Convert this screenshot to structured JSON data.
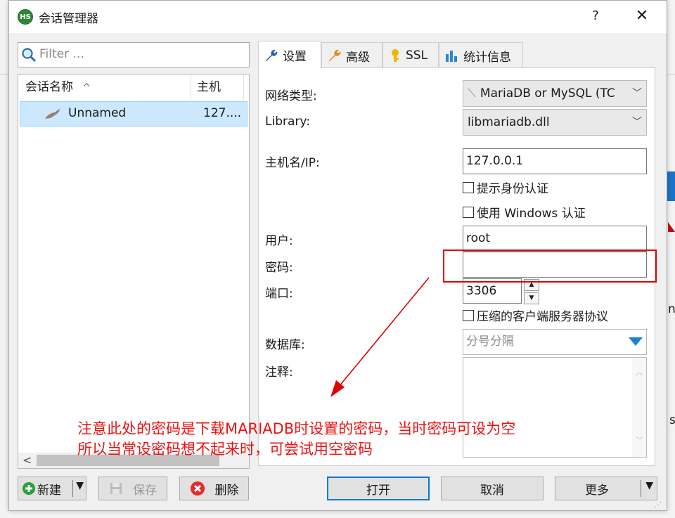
{
  "window": {
    "title": "会话管理器",
    "help_label": "?",
    "close_label": "✕",
    "app_icon_text": "HS"
  },
  "filter": {
    "placeholder": "Filter ..."
  },
  "session_list": {
    "columns": [
      {
        "label": "会话名称",
        "sort_indicator": "^"
      },
      {
        "label": "主机"
      }
    ],
    "rows": [
      {
        "name": "Unnamed",
        "host": "127...."
      }
    ],
    "scroll_left": "<"
  },
  "tabs": [
    {
      "label": "设置",
      "icon": "wrench-icon"
    },
    {
      "label": "高级",
      "icon": "wrench-icon"
    },
    {
      "label": "SSL",
      "icon": "key-icon"
    },
    {
      "label": "统计信息",
      "icon": "bar-chart-icon"
    }
  ],
  "settings": {
    "network_type_label": "网络类型:",
    "network_type_value": "MariaDB or MySQL (TC",
    "library_label": "Library:",
    "library_value": "libmariadb.dll",
    "host_label": "主机名/IP:",
    "host_value": "127.0.0.1",
    "prompt_auth_label": "提示身份认证",
    "windows_auth_label": "使用 Windows 认证",
    "user_label": "用户:",
    "user_value": "root",
    "password_label": "密码:",
    "password_value": "",
    "port_label": "端口:",
    "port_value": "3306",
    "compress_label": "压缩的客户端服务器协议",
    "database_label": "数据库:",
    "database_placeholder": "分号分隔",
    "comment_label": "注释:"
  },
  "buttons": {
    "new": "新建",
    "save": "保存",
    "delete": "删除",
    "open": "打开",
    "cancel": "取消",
    "more": "更多"
  },
  "annotation": {
    "line1": "注意此处的密码是下载MARIADB时设置的密码，当时密码可设为空",
    "line2": "所以当常设密码想不起来时，可尝试用空密码",
    "color": "#ee1111"
  },
  "background": {
    "text_n": "nc",
    "text_t": "st"
  }
}
